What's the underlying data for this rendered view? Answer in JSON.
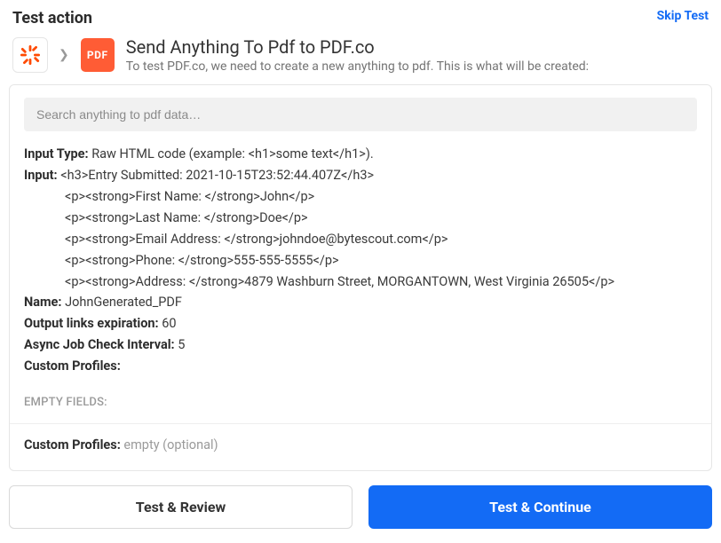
{
  "header": {
    "title": "Test action",
    "skip_label": "Skip Test"
  },
  "action": {
    "title": "Send Anything To Pdf to PDF.co",
    "subtitle": "To test PDF.co, we need to create a new anything to pdf. This is what will be created:",
    "pdf_badge": "PDF"
  },
  "search": {
    "placeholder": "Search anything to pdf data…"
  },
  "fields": {
    "input_type": {
      "label": "Input Type:",
      "value": "Raw HTML code (example: <h1>some text</h1>)."
    },
    "input": {
      "label": "Input:",
      "lines": [
        "<h3>Entry Submitted: 2021-10-15T23:52:44.407Z</h3>",
        "<p><strong>First Name: </strong>John</p>",
        "<p><strong>Last Name: </strong>Doe</p>",
        "<p><strong>Email Address: </strong>johndoe@bytescout.com</p>",
        "<p><strong>Phone: </strong>555-555-5555</p>",
        "<p><strong>Address: </strong>4879 Washburn Street, MORGANTOWN, West Virginia 26505</p>"
      ]
    },
    "name": {
      "label": "Name:",
      "value": "JohnGenerated_PDF"
    },
    "output_links_exp": {
      "label": "Output links expiration:",
      "value": "60"
    },
    "async_interval": {
      "label": "Async Job Check Interval:",
      "value": "5"
    },
    "custom_profiles": {
      "label": "Custom Profiles:",
      "value": ""
    }
  },
  "empty_section": {
    "heading": "EMPTY FIELDS:",
    "custom_profiles_label": "Custom Profiles:",
    "custom_profiles_value": "empty (optional)"
  },
  "buttons": {
    "review": "Test & Review",
    "continue": "Test & Continue"
  }
}
